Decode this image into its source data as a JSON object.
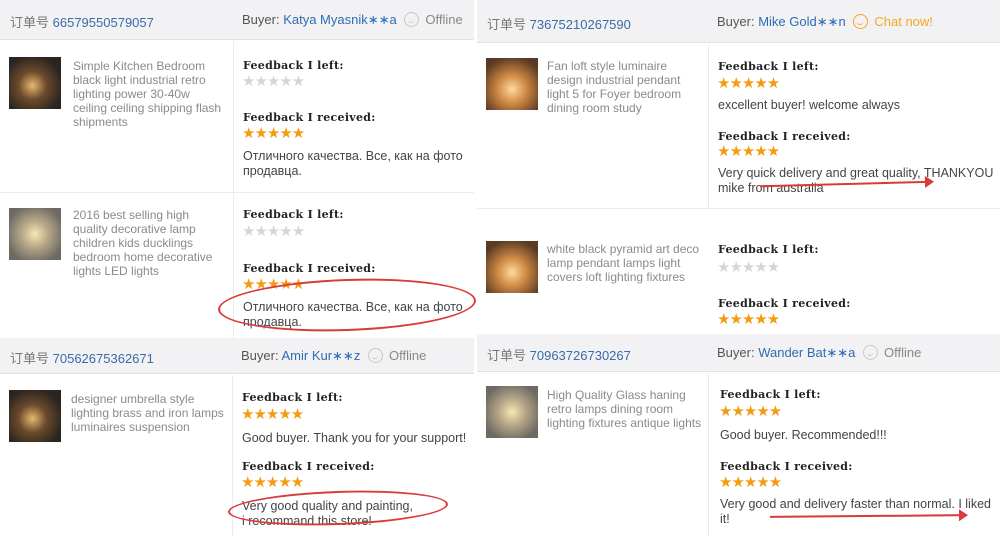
{
  "labels": {
    "order_prefix": "订单号",
    "buyer_prefix": "Buyer:",
    "feedback_left": "Feedback I left:",
    "feedback_received": "Feedback I received:"
  },
  "colors": {
    "accent": "#2d6db3",
    "star": "#f39c12",
    "annotation": "#d93a3a"
  },
  "icons": {
    "status": "smiley-face-icon",
    "rating": "star-icon"
  },
  "orders": [
    {
      "order_no": "66579550579057",
      "buyer": "Katya Myasnik∗∗a",
      "status": "Offline",
      "items": [
        {
          "title": "Simple Kitchen Bedroom black light industrial retro lighting power 30-40w ceiling ceiling shipping flash shipments",
          "left_stars": 0,
          "left_text": "",
          "received_stars": 5,
          "received_text": [
            "Отличного качества. Все, как на фото",
            "продавца."
          ]
        },
        {
          "title": "2016 best selling high quality decorative lamp children kids ducklings bedroom home decorative lights LED lights",
          "left_stars": 0,
          "left_text": "",
          "received_stars": 5,
          "received_text": [
            "Отличного качества. Все, как на фото",
            "продавца."
          ]
        }
      ]
    },
    {
      "order_no": "73675210267590",
      "buyer": "Mike Gold∗∗n",
      "status": "Chat now!",
      "items": [
        {
          "title": "Fan loft style luminaire design industrial pendant light 5 for Foyer bedroom dining room study",
          "left_stars": 5,
          "left_text": "excellent buyer! welcome always",
          "received_stars": 5,
          "received_text": [
            "Very quick delivery and great quality, THANKYOU",
            "mike from australia"
          ]
        },
        {
          "title": "white black pyramid art deco lamp pendant lamps light covers loft lighting fixtures",
          "left_stars": 0,
          "left_text": "",
          "received_stars": 5,
          "received_text": []
        }
      ]
    },
    {
      "order_no": "70562675362671",
      "buyer": "Amir Kur∗∗z",
      "status": "Offline",
      "items": [
        {
          "title": "designer umbrella style lighting brass and iron lamps luminaires suspension",
          "left_stars": 5,
          "left_text": "Good buyer. Thank you for your support!",
          "received_stars": 5,
          "received_text": [
            "Very good quality and painting,",
            "i recommand this store!"
          ]
        }
      ]
    },
    {
      "order_no": "70963726730267",
      "buyer": "Wander Bat∗∗a",
      "status": "Offline",
      "items": [
        {
          "title": "High Quality Glass haning retro lamps dining room lighting fixtures antique lights",
          "left_stars": 5,
          "left_text": "Good buyer. Recommended!!!",
          "received_stars": 5,
          "received_text": [
            "Very good and delivery faster than normal. I liked",
            "it!"
          ]
        }
      ]
    }
  ]
}
